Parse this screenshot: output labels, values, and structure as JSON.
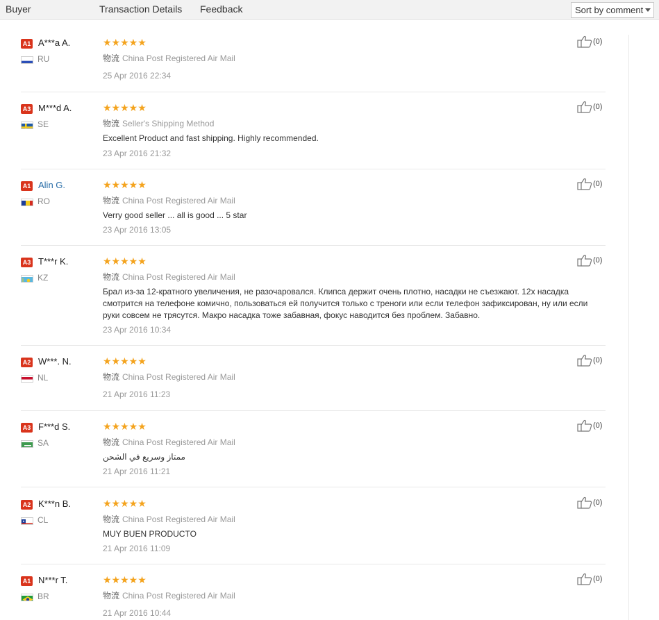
{
  "header": {
    "col_buyer": "Buyer",
    "col_transaction": "Transaction Details",
    "col_feedback": "Feedback",
    "sort_selected": "Sort by comment"
  },
  "reviews": [
    {
      "level": "A1",
      "name": "A***a A.",
      "country": "RU",
      "stars": "★★★★★",
      "logistics_label": "物流",
      "logistics": "China Post Registered Air Mail",
      "comment": "",
      "date": "25 Apr 2016 22:34",
      "helpful": "(0)"
    },
    {
      "level": "A3",
      "name": "M***d A.",
      "country": "SE",
      "stars": "★★★★★",
      "logistics_label": "物流",
      "logistics": "Seller's Shipping Method",
      "comment": "Excellent Product and fast shipping. Highly recommended.",
      "date": "23 Apr 2016 21:32",
      "helpful": "(0)"
    },
    {
      "level": "A1",
      "name": "Alin G.",
      "country": "RO",
      "stars": "★★★★★",
      "logistics_label": "物流",
      "logistics": "China Post Registered Air Mail",
      "comment": "Verry good seller ... all is good ... 5 star",
      "date": "23 Apr 2016 13:05",
      "helpful": "(0)"
    },
    {
      "level": "A3",
      "name": "T***r K.",
      "country": "KZ",
      "stars": "★★★★★",
      "logistics_label": "物流",
      "logistics": "China Post Registered Air Mail",
      "comment": "Брал из-за 12-кратного увеличения, не разочаровался. Клипса держит очень плотно, насадки не съезжают. 12x насадка смотрится на телефоне комично, пользоваться ей получится только с треноги или если телефон зафиксирован, ну или если руки совсем не трясутся. Макро насадка тоже забавная, фокус наводится без проблем. Забавно.",
      "date": "23 Apr 2016 10:34",
      "helpful": "(0)"
    },
    {
      "level": "A2",
      "name": "W***. N.",
      "country": "NL",
      "stars": "★★★★★",
      "logistics_label": "物流",
      "logistics": "China Post Registered Air Mail",
      "comment": "",
      "date": "21 Apr 2016 11:23",
      "helpful": "(0)"
    },
    {
      "level": "A3",
      "name": "F***d S.",
      "country": "SA",
      "stars": "★★★★★",
      "logistics_label": "物流",
      "logistics": "China Post Registered Air Mail",
      "comment": "ممتاز وسريع في الشحن",
      "date": "21 Apr 2016 11:21",
      "helpful": "(0)"
    },
    {
      "level": "A2",
      "name": "K***n B.",
      "country": "CL",
      "stars": "★★★★★",
      "logistics_label": "物流",
      "logistics": "China Post Registered Air Mail",
      "comment": "MUY BUEN PRODUCTO",
      "date": "21 Apr 2016 11:09",
      "helpful": "(0)"
    },
    {
      "level": "A1",
      "name": "N***r T.",
      "country": "BR",
      "stars": "★★★★★",
      "logistics_label": "物流",
      "logistics": "China Post Registered Air Mail",
      "comment": "",
      "date": "21 Apr 2016 10:44",
      "helpful": "(0)"
    }
  ],
  "colors": {
    "badge": "#d9341c",
    "star": "#f4a31d",
    "link": "#2a6ea8"
  }
}
